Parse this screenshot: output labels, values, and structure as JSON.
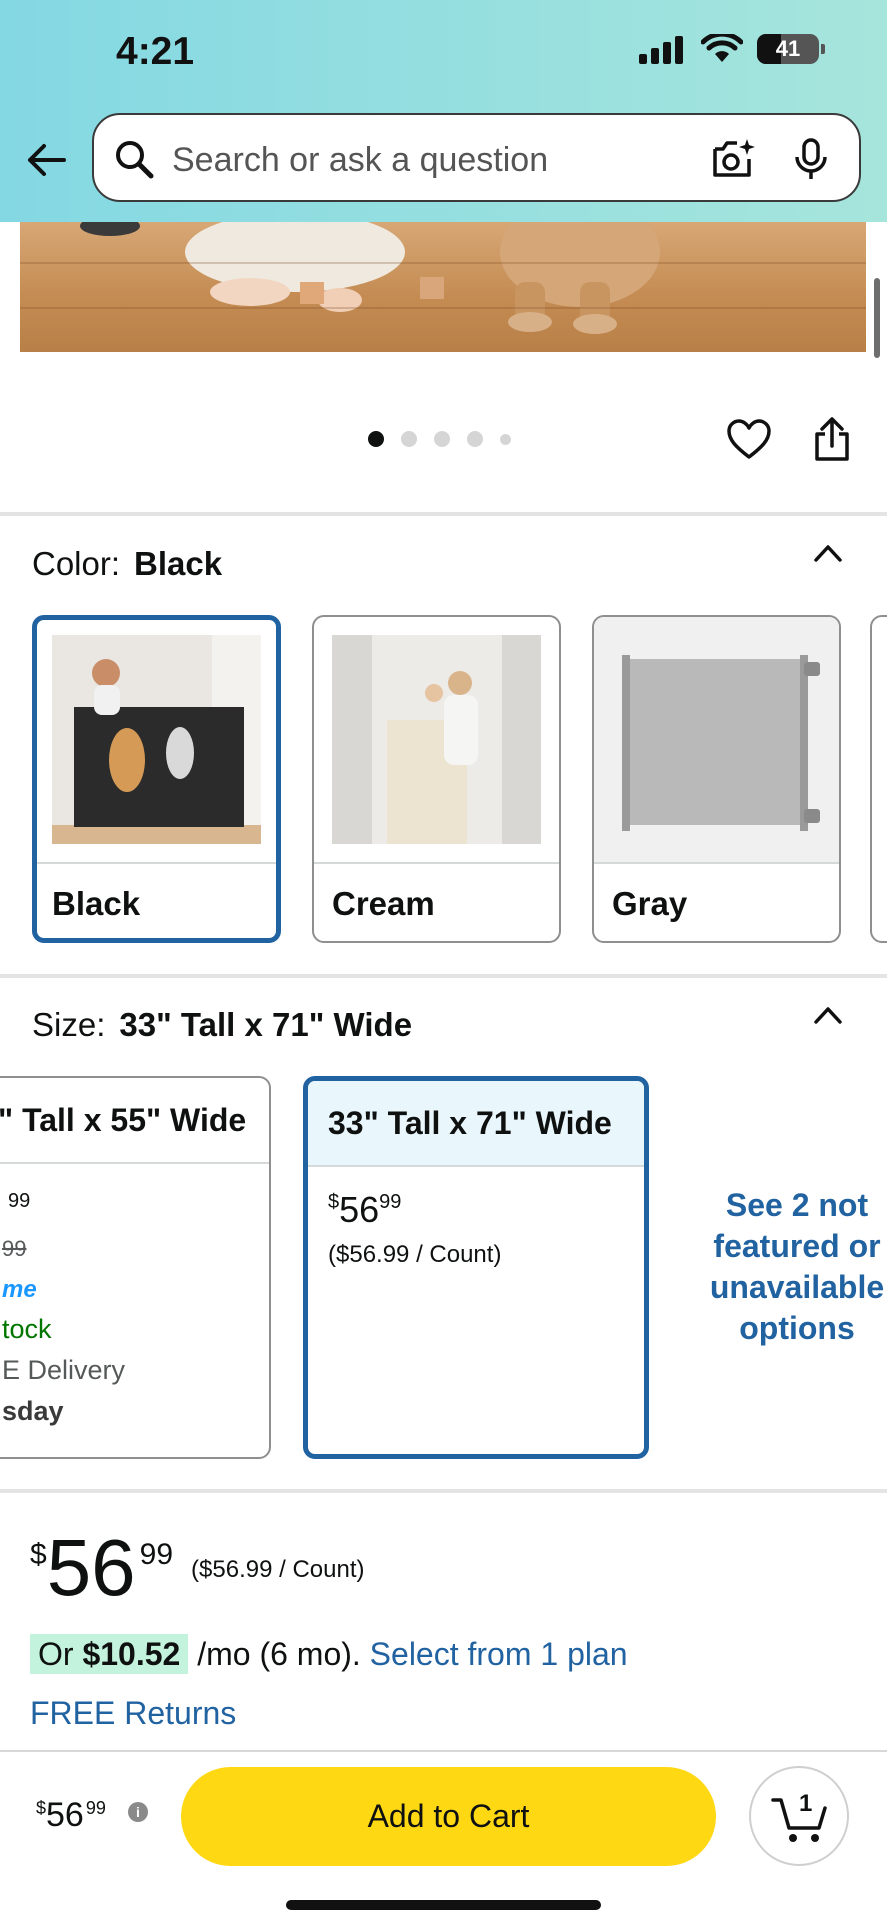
{
  "status": {
    "time": "4:21",
    "battery": "41"
  },
  "search": {
    "placeholder": "Search or ask a question"
  },
  "color": {
    "label": "Color:",
    "selected": "Black",
    "options": [
      {
        "name": "Black"
      },
      {
        "name": "Cream"
      },
      {
        "name": "Gray"
      }
    ]
  },
  "size": {
    "label": "Size:",
    "selected": "33\" Tall x 71\" Wide",
    "options": [
      {
        "title": "\" Tall x 55\" Wide",
        "price_cents": "99",
        "list_price_cents": "99",
        "prime": "me",
        "stock": "tock",
        "delivery": "E Delivery",
        "day": "sday"
      },
      {
        "title": "33\" Tall x 71\" Wide",
        "price_symbol": "$",
        "price_dollars": "56",
        "price_cents": "99",
        "unit": "($56.99 / Count)"
      }
    ],
    "see_more": "See 2 not featured or unavailable options"
  },
  "price": {
    "symbol": "$",
    "dollars": "56",
    "cents": "99",
    "unit": "($56.99 / Count)"
  },
  "financing": {
    "or_text": "Or",
    "amount": "$10.52",
    "term": " /mo (6 mo). ",
    "link": "Select from 1 plan"
  },
  "returns": "FREE Returns",
  "bottom_bar": {
    "price_symbol": "$",
    "price_dollars": "56",
    "price_cents": "99",
    "add_to_cart": "Add to Cart",
    "cart_count": "1"
  },
  "colors": {
    "accent_blue": "#2162a1",
    "cart_yellow": "#ffd814",
    "stock_green": "#007600",
    "prime_blue": "#1a98ff"
  }
}
